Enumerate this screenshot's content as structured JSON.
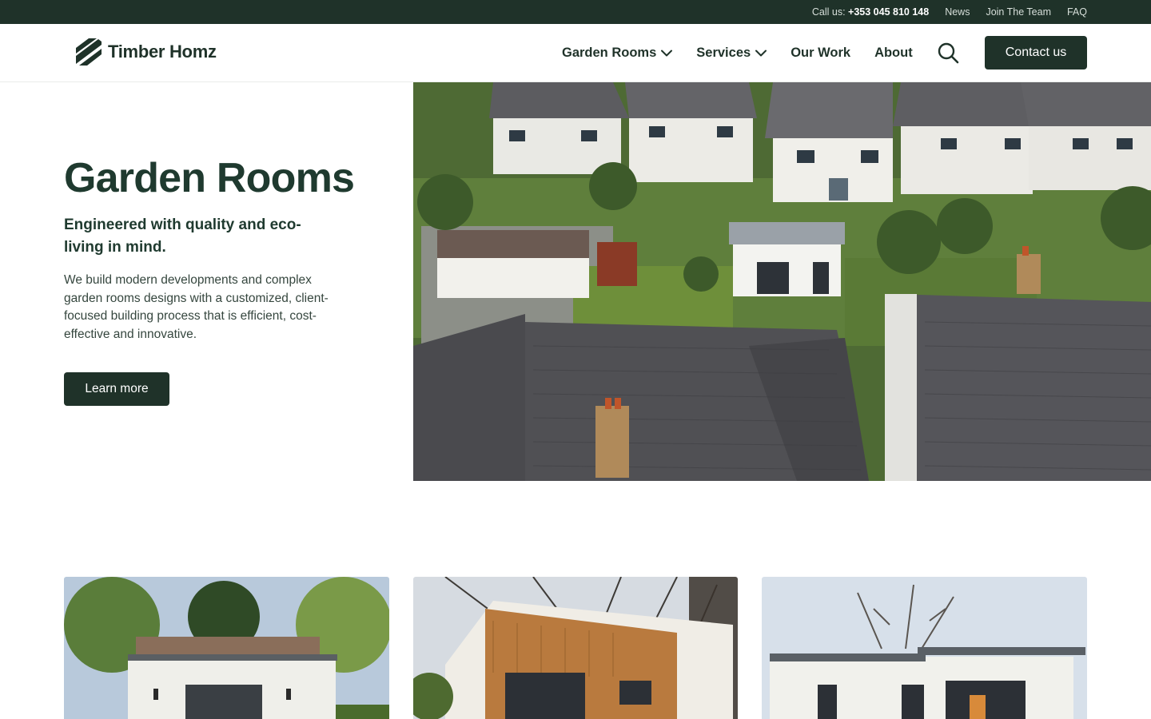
{
  "topbar": {
    "call_prefix": "Call us:",
    "phone": "+353 045 810 148",
    "links": [
      "News",
      "Join The Team",
      "FAQ"
    ]
  },
  "header": {
    "logo_text": "Timber Homz",
    "nav": [
      {
        "label": "Garden Rooms",
        "has_dropdown": true
      },
      {
        "label": "Services",
        "has_dropdown": true
      },
      {
        "label": "Our Work",
        "has_dropdown": false
      },
      {
        "label": "About",
        "has_dropdown": false
      }
    ],
    "search_icon": "search-icon",
    "cta_label": "Contact us"
  },
  "hero": {
    "title": "Garden Rooms",
    "subtitle": "Engineered with quality and eco-living in mind.",
    "description": "We build modern developments and complex garden rooms designs with a customized, client-focused building process that is efficient, cost-effective and innovative.",
    "button_label": "Learn more"
  },
  "colors": {
    "brand_dark": "#1f3229",
    "heading": "#1f3a2f",
    "white": "#ffffff"
  }
}
